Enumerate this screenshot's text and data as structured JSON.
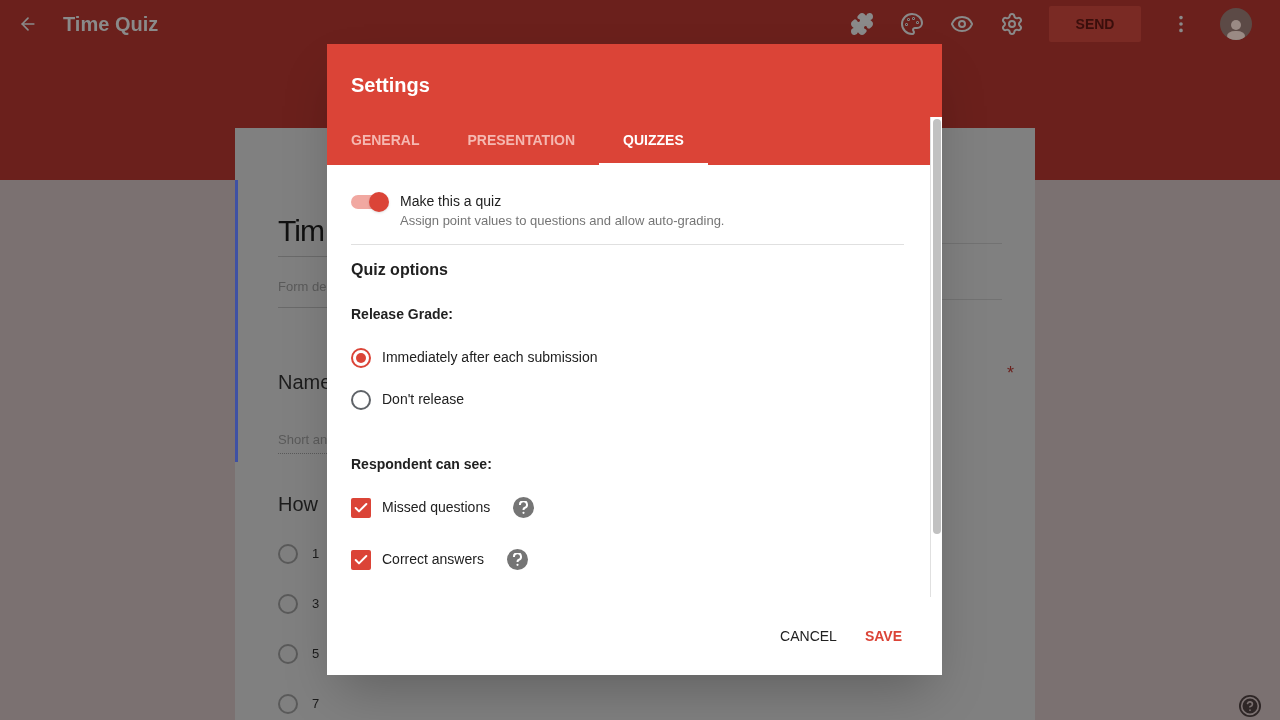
{
  "app_bar": {
    "title": "Time Quiz",
    "send_button": "SEND"
  },
  "form": {
    "title": "Tim",
    "description": "Form de",
    "questions": [
      {
        "kind": "text",
        "title": "Name",
        "placeholder": "Short an",
        "required_mark": "*"
      },
      {
        "kind": "choice",
        "title": "How",
        "options": [
          {
            "label": "1",
            "selected": false
          },
          {
            "label": "3",
            "selected": false
          },
          {
            "label": "5",
            "selected": false
          },
          {
            "label": "7",
            "selected": false
          }
        ]
      }
    ]
  },
  "dialog": {
    "title": "Settings",
    "tabs": [
      {
        "label": "GENERAL",
        "selected": false
      },
      {
        "label": "PRESENTATION",
        "selected": false
      },
      {
        "label": "QUIZZES",
        "selected": true
      }
    ],
    "quiz_toggle": {
      "label": "Make this a quiz",
      "description": "Assign point values to questions and allow auto-grading.",
      "on": true
    },
    "section_title": "Quiz options",
    "release_grade": {
      "label": "Release Grade:",
      "options": [
        {
          "label": "Immediately after each submission",
          "selected": true
        },
        {
          "label": "Don't release",
          "selected": false
        }
      ]
    },
    "respondent": {
      "label": "Respondent can see:",
      "options": [
        {
          "label": "Missed questions",
          "checked": true
        },
        {
          "label": "Correct answers",
          "checked": true
        }
      ]
    },
    "buttons": [
      {
        "label": "CANCEL",
        "kind": "secondary"
      },
      {
        "label": "SAVE",
        "kind": "primary"
      }
    ]
  }
}
